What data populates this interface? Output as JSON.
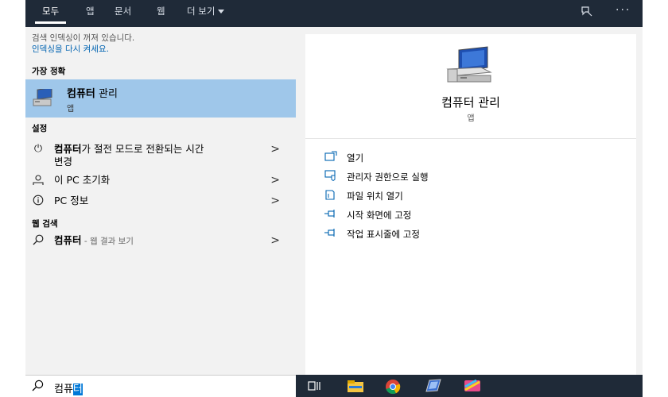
{
  "tabs": [
    {
      "label": "모두",
      "active": true
    },
    {
      "label": "앱"
    },
    {
      "label": "문서"
    },
    {
      "label": "웹"
    },
    {
      "label": "더 보기"
    }
  ],
  "top_icons": {
    "feedback": "feedback-icon",
    "more": "···"
  },
  "notice": {
    "text": "검색 인덱싱이 꺼져 있습니다.",
    "link": "인덱싱을 다시 켜세요."
  },
  "sections": {
    "best_match": "가장 정확",
    "settings": "설정",
    "web": "웹 검색"
  },
  "best_match": {
    "title_bold": "컴퓨터",
    "title_rest": " 관리",
    "subtitle": "앱"
  },
  "settings_items": [
    {
      "icon": "power-icon",
      "bold": "컴퓨터",
      "rest": "가 절전 모드로 전환되는 시간",
      "line2": "변경"
    },
    {
      "icon": "reset-pc-icon",
      "text": "이 PC 초기화"
    },
    {
      "icon": "info-icon",
      "text": "PC 정보"
    }
  ],
  "web_item": {
    "bold": "컴퓨터",
    "muted": " - 웹 결과 보기"
  },
  "details": {
    "title": "컴퓨터 관리",
    "subtitle": "앱",
    "actions": [
      {
        "icon": "open-icon",
        "label": "열기"
      },
      {
        "icon": "run-as-admin-icon",
        "label": "관리자 권한으로 실행"
      },
      {
        "icon": "open-file-location-icon",
        "label": "파일 위치 열기"
      },
      {
        "icon": "pin-start-icon",
        "label": "시작 화면에 고정"
      },
      {
        "icon": "pin-taskbar-icon",
        "label": "작업 표시줄에 고정"
      }
    ]
  },
  "search": {
    "query_plain": "컴퓨",
    "query_selected": "터"
  },
  "colors": {
    "accent": "#0078d7",
    "topbar": "#1f2a38",
    "highlight": "#9fc7ea",
    "pane": "#f2f2f2"
  }
}
